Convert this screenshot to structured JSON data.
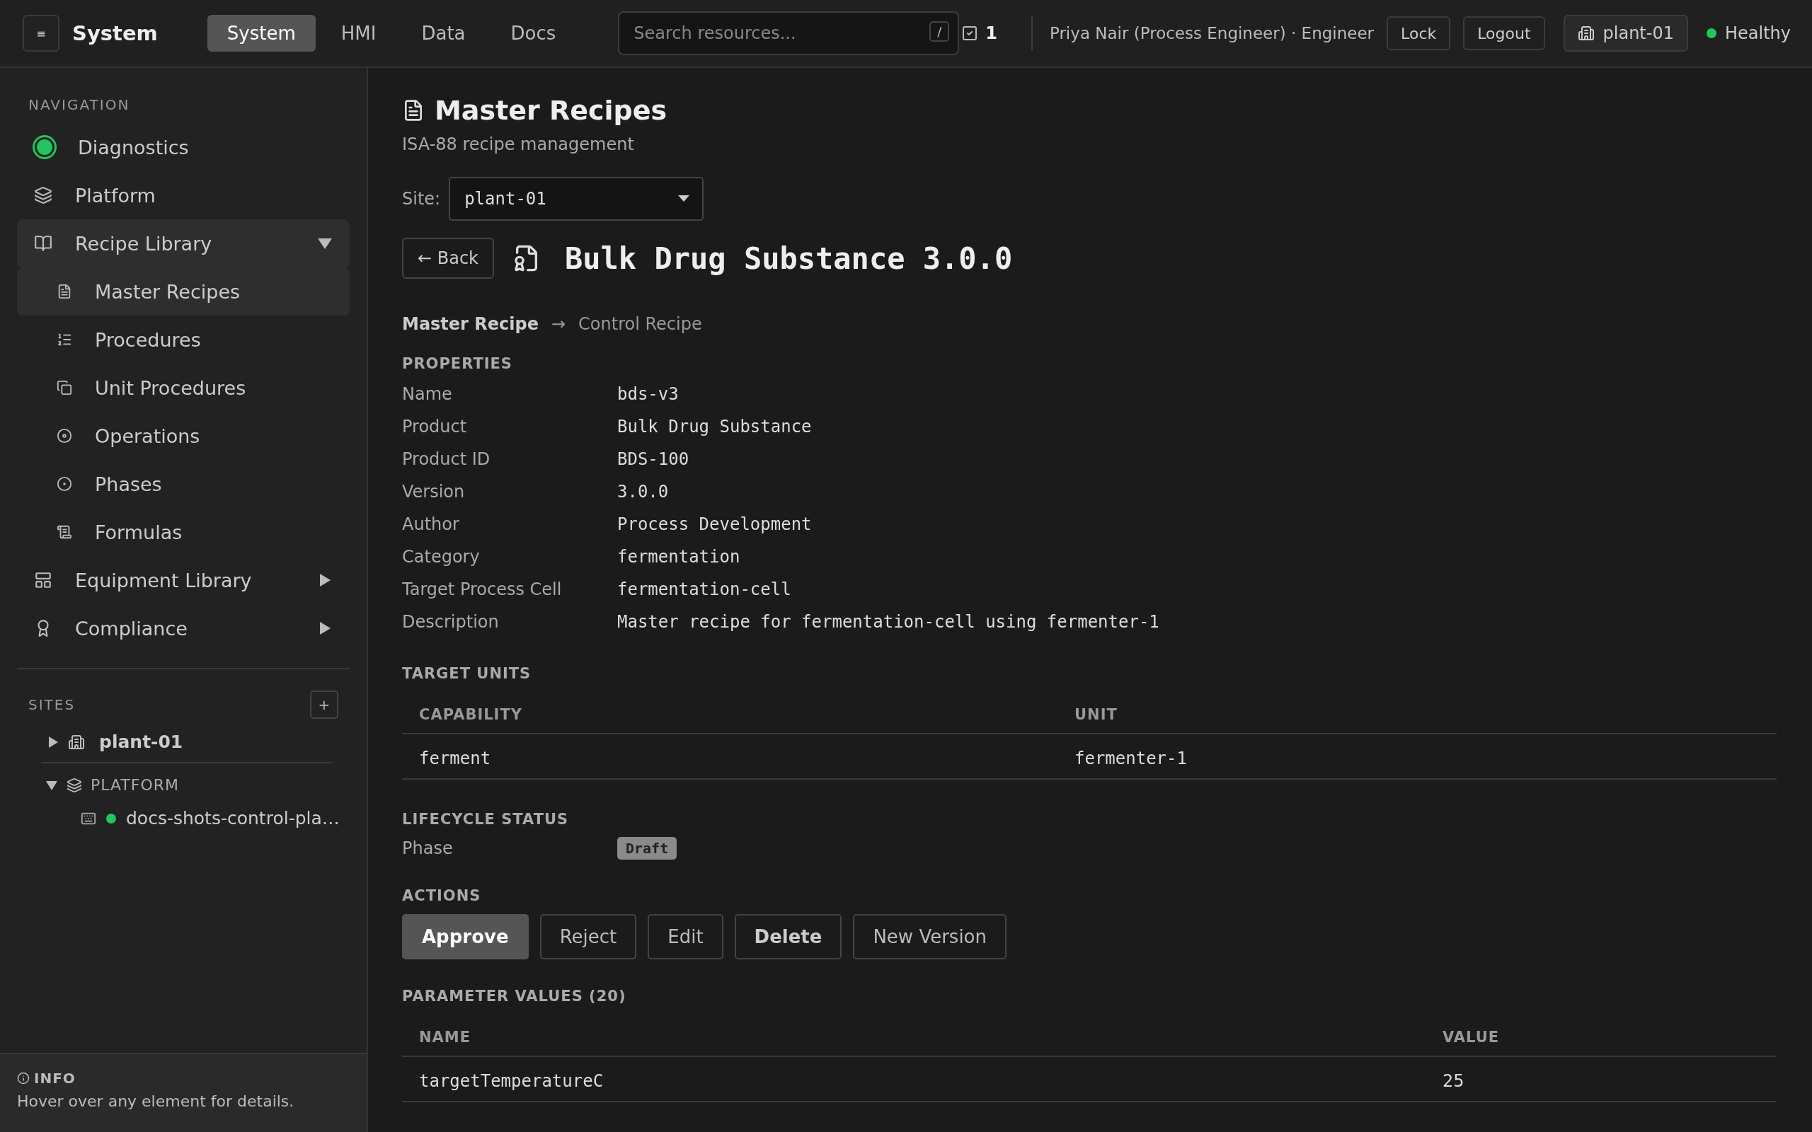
{
  "topbar": {
    "menu_button": "≡",
    "brand": "System",
    "tabs": [
      {
        "label": "System",
        "selected": true
      },
      {
        "label": "HMI",
        "selected": false
      },
      {
        "label": "Data",
        "selected": false
      },
      {
        "label": "Docs",
        "selected": false
      }
    ],
    "search": {
      "placeholder": "Search resources...",
      "shortcut": "/"
    },
    "task_count": "1",
    "user": "Priya Nair (Process Engineer) · Engineer",
    "buttons": [
      "Lock",
      "Logout"
    ],
    "site_button": "plant-01",
    "status": {
      "label": "Healthy",
      "color": "#22c55e"
    }
  },
  "sidebar": {
    "heading": "NAVIGATION",
    "items": [
      {
        "label": "Diagnostics",
        "selected": false,
        "color": "#22c55e"
      },
      {
        "label": "Platform",
        "selected": false
      },
      {
        "label": "Recipe Library",
        "selected": false,
        "expanded": true,
        "children": [
          {
            "label": "Master Recipes",
            "selected": true
          },
          {
            "label": "Procedures",
            "selected": false
          },
          {
            "label": "Unit Procedures",
            "selected": false
          },
          {
            "label": "Operations",
            "selected": false
          },
          {
            "label": "Phases",
            "selected": false
          },
          {
            "label": "Formulas",
            "selected": false
          }
        ]
      },
      {
        "label": "Equipment Library",
        "selected": false,
        "expanded": false
      },
      {
        "label": "Compliance",
        "selected": false,
        "expanded": false
      }
    ],
    "sites": {
      "heading": "SITES",
      "add_button": "+",
      "items": [
        {
          "label": "plant-01",
          "expanded": false
        }
      ]
    },
    "platform": {
      "label": "PLATFORM",
      "expanded": true,
      "children": [
        {
          "label": "docs-shots-control-pla…",
          "color": "#22c55e"
        }
      ]
    },
    "info": {
      "heading": "INFO",
      "text": "Hover over any element for details."
    }
  },
  "main": {
    "title": "Master Recipes",
    "subtitle": "ISA-88 recipe management",
    "site_select": {
      "label": "Site:",
      "value": "plant-01"
    },
    "back_button": "← Back",
    "recipe_title": "Bulk Drug Substance 3.0.0",
    "breadcrumb": {
      "separator": "→",
      "items": [
        {
          "label": "Master Recipe",
          "selected": true
        },
        {
          "label": "Control Recipe",
          "selected": false
        }
      ]
    },
    "properties": {
      "heading": "PROPERTIES",
      "rows": [
        {
          "label": "Name",
          "value": "bds-v3"
        },
        {
          "label": "Product",
          "value": "Bulk Drug Substance"
        },
        {
          "label": "Product ID",
          "value": "BDS-100"
        },
        {
          "label": "Version",
          "value": "3.0.0"
        },
        {
          "label": "Author",
          "value": "Process Development"
        },
        {
          "label": "Category",
          "value": "fermentation"
        },
        {
          "label": "Target Process Cell",
          "value": "fermentation-cell"
        },
        {
          "label": "Description",
          "value": "Master recipe for fermentation-cell using fermenter-1"
        }
      ]
    },
    "target_units": {
      "heading": "TARGET UNITS",
      "columns": [
        "CAPABILITY",
        "UNIT"
      ],
      "rows": [
        [
          "ferment",
          "fermenter-1"
        ]
      ]
    },
    "lifecycle": {
      "heading": "LIFECYCLE STATUS",
      "label": "Phase",
      "badge": "Draft"
    },
    "actions": {
      "heading": "ACTIONS",
      "buttons": [
        {
          "label": "Approve",
          "kind": "primary"
        },
        {
          "label": "Reject",
          "kind": "default"
        },
        {
          "label": "Edit",
          "kind": "default"
        },
        {
          "label": "Delete",
          "kind": "strong"
        },
        {
          "label": "New Version",
          "kind": "default"
        }
      ]
    },
    "parameters": {
      "heading": "PARAMETER VALUES (20)",
      "columns": [
        "NAME",
        "VALUE"
      ],
      "rows": [
        [
          "targetTemperatureC",
          "25"
        ]
      ]
    }
  }
}
